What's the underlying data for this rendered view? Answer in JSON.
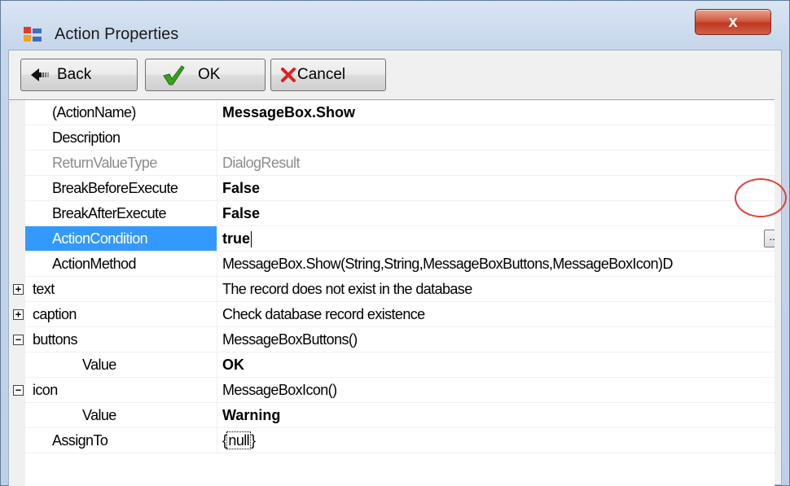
{
  "window": {
    "title": "Action Properties",
    "close_label": "x"
  },
  "toolbar": {
    "back_label": "Back",
    "ok_label": "OK",
    "cancel_label": "Cancel"
  },
  "grid": {
    "rows": [
      {
        "name": "(ActionName)",
        "value": "MessageBox.Show"
      },
      {
        "name": "Description",
        "value": ""
      },
      {
        "name": "ReturnValueType",
        "value": "DialogResult"
      },
      {
        "name": "BreakBeforeExecute",
        "value": "False"
      },
      {
        "name": "BreakAfterExecute",
        "value": "False"
      },
      {
        "name": "ActionCondition",
        "value": "true",
        "button": "..."
      },
      {
        "name": "ActionMethod",
        "value": "MessageBox.Show(String,String,MessageBoxButtons,MessageBoxIcon)D"
      },
      {
        "name": "text",
        "value": "The record does not exist in the database",
        "expander": "+"
      },
      {
        "name": "caption",
        "value": "Check database record existence",
        "expander": "+"
      },
      {
        "name": "buttons",
        "value": "MessageBoxButtons()",
        "expander": "−"
      },
      {
        "name": "Value",
        "value": "OK"
      },
      {
        "name": "icon",
        "value": "MessageBoxIcon()",
        "expander": "−"
      },
      {
        "name": "Value",
        "value": "Warning"
      },
      {
        "name": "AssignTo",
        "value_prefix": "{",
        "value_boxed": "null",
        "value_suffix": "}"
      }
    ]
  },
  "colors": {
    "selection": "#3399ff",
    "highlight_ring": "#e0403a",
    "close_button": "#c0381f"
  },
  "icons": {
    "app": "property-grid-icon",
    "back": "back-arrow-icon",
    "ok": "green-check-icon",
    "cancel": "red-x-icon"
  }
}
